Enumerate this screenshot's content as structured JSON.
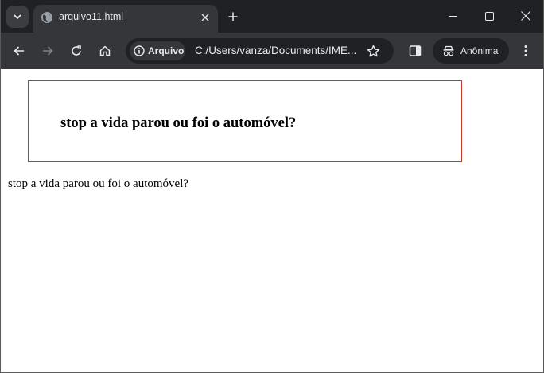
{
  "browser": {
    "tab": {
      "title": "arquivo11.html"
    },
    "address_bar": {
      "chip_label": "Arquivo",
      "url": "C:/Users/vanza/Documents/IME..."
    },
    "profile": {
      "label": "Anônima"
    }
  },
  "page": {
    "boxed_heading": "stop a vida parou ou foi o automóvel?",
    "plain_text": "stop a vida parou ou foi o automóvel?"
  },
  "colors": {
    "tabstrip_bg": "#202124",
    "toolbar_bg": "#35363a",
    "box_border": "#c0392b"
  },
  "icons": [
    "tab-search-icon",
    "globe-icon",
    "close-icon",
    "plus-icon",
    "minimize-icon",
    "maximize-icon",
    "window-close-icon",
    "back-arrow-icon",
    "forward-arrow-icon",
    "reload-icon",
    "home-icon",
    "info-icon",
    "star-icon",
    "side-panel-icon",
    "incognito-icon",
    "kebab-menu-icon"
  ]
}
